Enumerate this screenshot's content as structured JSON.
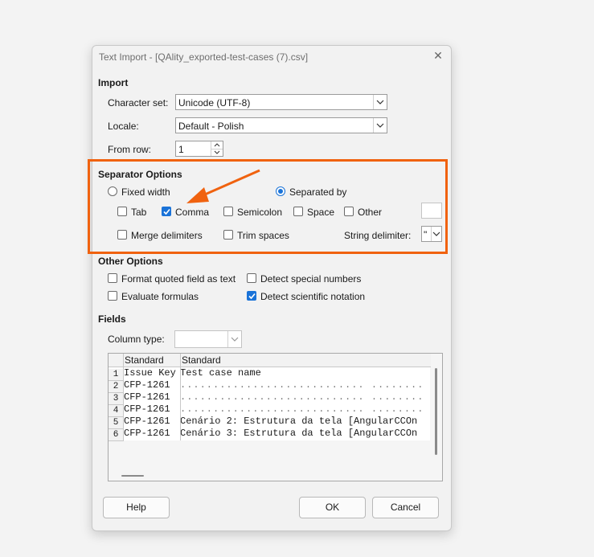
{
  "dialog": {
    "title": "Text Import - [QAlity_exported-test-cases (7).csv]"
  },
  "import": {
    "heading": "Import",
    "charset_label": "Character set:",
    "charset_value": "Unicode (UTF-8)",
    "locale_label": "Locale:",
    "locale_value": "Default - Polish",
    "fromrow_label": "From row:",
    "fromrow_value": "1"
  },
  "separator": {
    "heading": "Separator Options",
    "fixed_width": "Fixed width",
    "separated_by": "Separated by",
    "tab": "Tab",
    "comma": "Comma",
    "semicolon": "Semicolon",
    "space": "Space",
    "other": "Other",
    "merge": "Merge delimiters",
    "trim": "Trim spaces",
    "string_delim_label": "String delimiter:",
    "string_delim_value": "\""
  },
  "other_options": {
    "heading": "Other Options",
    "format_quoted": "Format quoted field as text",
    "detect_special": "Detect special numbers",
    "evaluate": "Evaluate formulas",
    "detect_scientific": "Detect scientific notation"
  },
  "fields": {
    "heading": "Fields",
    "column_type_label": "Column type:",
    "column_type_value": "",
    "headers": [
      "Standard",
      "Standard"
    ],
    "rows": [
      {
        "num": "1",
        "c1": "Issue Key",
        "c2": "Test case name"
      },
      {
        "num": "2",
        "c1": "CFP-1261",
        "c2": "............................   ........"
      },
      {
        "num": "3",
        "c1": "CFP-1261",
        "c2": "............................   ........"
      },
      {
        "num": "4",
        "c1": "CFP-1261",
        "c2": "............................   ........"
      },
      {
        "num": "5",
        "c1": "CFP-1261",
        "c2": " Cenário 2: Estrutura da tela  [AngularCCOn"
      },
      {
        "num": "6",
        "c1": "CFP-1261",
        "c2": " Cenário 3: Estrutura da tela  [AngularCCOn"
      }
    ]
  },
  "buttons": {
    "help": "Help",
    "ok": "OK",
    "cancel": "Cancel"
  },
  "colors": {
    "accent": "#1a73d8",
    "annotation": "#f0620f"
  }
}
